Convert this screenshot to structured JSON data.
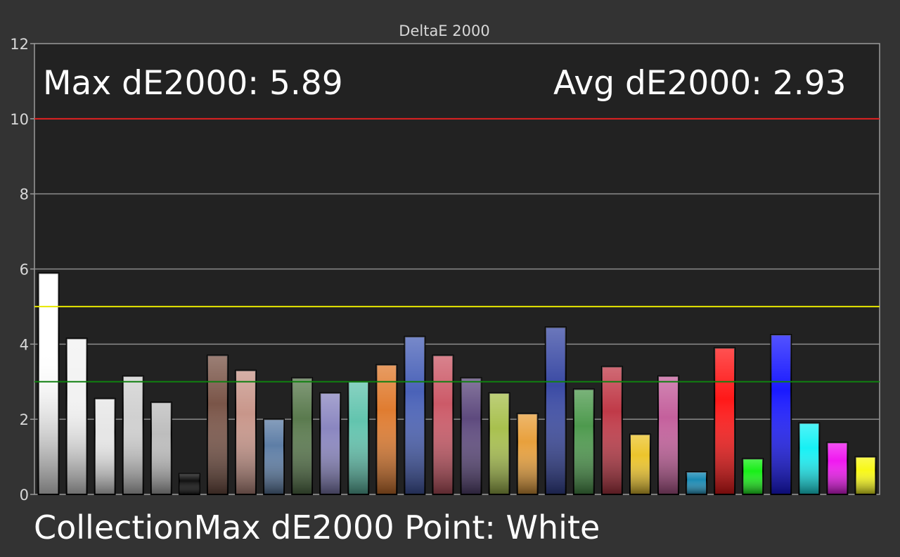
{
  "chart_data": {
    "type": "bar",
    "title": "DeltaE 2000",
    "xlabel": "",
    "ylabel": "",
    "ylim": [
      0,
      12
    ],
    "yticks": [
      0,
      2,
      4,
      6,
      8,
      10,
      12
    ],
    "grid": true,
    "reference_lines": [
      {
        "value": 10,
        "color": "#e02020"
      },
      {
        "value": 5,
        "color": "#e8e800"
      },
      {
        "value": 3,
        "color": "#108010"
      }
    ],
    "stats": {
      "max_text": "Max dE2000: 5.89",
      "avg_text": "Avg dE2000: 2.93"
    },
    "footer_text": "CollectionMax dE2000 Point: White",
    "values": [
      5.89,
      4.15,
      2.55,
      3.15,
      2.45,
      0.55,
      3.7,
      3.3,
      2.0,
      3.1,
      2.7,
      3.0,
      3.45,
      4.2,
      3.7,
      3.1,
      2.7,
      2.15,
      4.45,
      2.8,
      3.4,
      1.6,
      3.15,
      0.6,
      3.9,
      0.95,
      4.25,
      1.9,
      1.38,
      1.0
    ],
    "colors": [
      "#ffffff",
      "#f2f2f2",
      "#e6e6e6",
      "#d0d0d0",
      "#bdbdbd",
      "#111111",
      "#7a5548",
      "#c8968a",
      "#5e7ea6",
      "#5a7a4e",
      "#8a86c0",
      "#62c4ae",
      "#e07c30",
      "#4a62b8",
      "#cc5a68",
      "#5e4a7e",
      "#a8c04e",
      "#e8a03c",
      "#3a4aa4",
      "#4e9a4e",
      "#c03a48",
      "#ecc42c",
      "#c4609c",
      "#1a8ab4",
      "#ff1818",
      "#18ee18",
      "#1a1aff",
      "#18f0f4",
      "#f018f0",
      "#f8f818"
    ]
  }
}
